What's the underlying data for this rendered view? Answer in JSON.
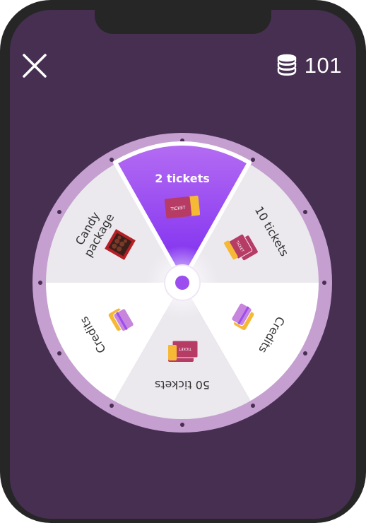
{
  "header": {
    "close_icon": "close-icon",
    "coin_icon": "coin-stack-icon",
    "coin_count": "101"
  },
  "wheel": {
    "colors": {
      "rim": "#c49fcf",
      "rim_dots": "#472f52",
      "segment_light": "#ebe8ee",
      "segment_white": "#ffffff",
      "highlight_top": "#b56cf2",
      "highlight_bottom": "#7a2af0",
      "hub_dot": "#9b4df0"
    },
    "highlighted_prize": "2 tickets",
    "prizes": [
      {
        "label": "2 tickets",
        "icon": "ticket-icon"
      },
      {
        "label": "10 tickets",
        "icon": "ticket-stack-icon"
      },
      {
        "label": "Credits",
        "icon": "credit-cards-icon"
      },
      {
        "label": "50 tickets",
        "icon": "ticket-stack-icon"
      },
      {
        "label": "Credits",
        "icon": "credit-cards-icon"
      },
      {
        "label_line1": "Candy",
        "label_line2": "package",
        "icon": "candy-box-icon"
      }
    ]
  }
}
